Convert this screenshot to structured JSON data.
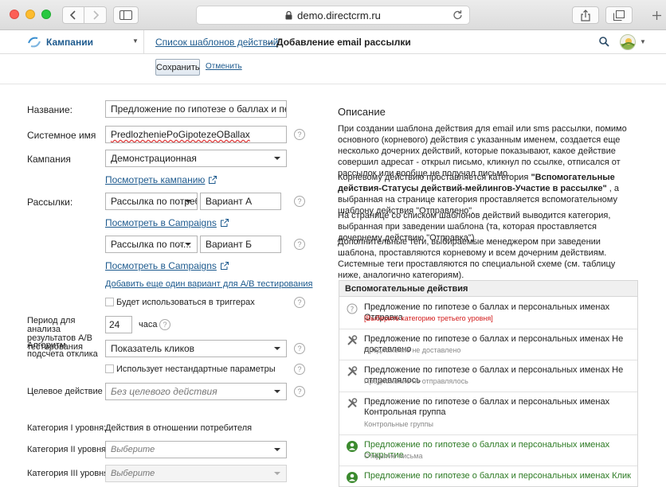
{
  "browser": {
    "url": "demo.directcrm.ru"
  },
  "header": {
    "section": "Кампании",
    "breadcrumb_link": "Список шаблонов действий",
    "breadcrumb_arrow": "→",
    "breadcrumb_current": "Добавление email рассылки"
  },
  "toolbar": {
    "save_label": "Сохранить",
    "cancel_label": "Отменить"
  },
  "form": {
    "name_label": "Название:",
    "name_value": "Предложение по гипотезе о баллах и персональн",
    "sysname_label": "Системное имя",
    "sysname_value": "PredlozheniePoGipotezeOBallax",
    "campaign_label": "Кампания",
    "campaign_value": "Демонстрационная",
    "view_campaign": "Посмотреть кампанию",
    "mailings_label": "Рассылки:",
    "mailing_a_select": "Рассылка по потребе...",
    "mailing_a_variant": "Вариант А",
    "view_in_campaigns_a": "Посмотреть в Campaigns",
    "mailing_b_select": "Рассылка по пот...",
    "mailing_b_variant": "Вариант Б",
    "view_in_campaigns_b": "Посмотреть в Campaigns",
    "add_variant": "Добавить еще один вариант для A/B тестирования",
    "used_in_triggers": "Будет использоваться в триггерах",
    "period_label": "Период для анализа результатов A/B тестирования",
    "period_value": "24",
    "period_unit": "часа",
    "algo_label": "Алгоритм подсчета отклика",
    "algo_value": "Показатель кликов",
    "nonstandard_params": "Использует нестандартные параметры",
    "target_label": "Целевое действие",
    "target_placeholder": "Без целевого действия",
    "cat1_label": "Категория I уровня:",
    "cat1_value": "Действия в отношении потребителя",
    "cat2_label": "Категория II уровня",
    "cat2_placeholder": "Выберите",
    "cat3_label": "Категория III уровня",
    "cat3_placeholder": "Выберите"
  },
  "description": {
    "title": "Описание",
    "p1": "При создании шаблона действия для email или sms рассылки, помимо основного (корневого) действия с указанным именем, создается еще несколько дочерних действий, которые показывают, какое действие совершил адресат - открыл письмо, кликнул по ссылке, отписался от рассылок или вообще не получал письмо.",
    "p2_a": "Корневому действию проставляется категория ",
    "p2_b": "\"Вспомогательные действия-Статусы действий-мейлингов-Участие в рассылке\"",
    "p2_c": " , а выбранная на странице категория проставляется вспомогательному шаблону действия \"Отправлено\".",
    "p3": "На странице со списком шаблонов действий выводится категория, выбранная при заведении шаблона (та, которая проставляется дочернему действию \"Отправка\").",
    "p4": "Дополнительные теги, выбираемые менеджером при заведении шаблона, проставляются корневому и всем дочерним действиям. Системные теги проставляются по специальной схеме (см. таблицу ниже, аналогично категориям)."
  },
  "actions_panel": {
    "header": "Вспомогательные действия",
    "items": [
      {
        "icon": "question-circle-icon",
        "title": "Предложение по гипотезе о баллах и персональных именах Отправка",
        "sub": "[Выберите категорию третьего уровня]",
        "sub_style": "error"
      },
      {
        "icon": "tools-icon",
        "title": "Предложение по гипотезе о баллах и персональных именах Не доставлено",
        "sub": "Предложение не доставлено"
      },
      {
        "icon": "tools-icon",
        "title": "Предложение по гипотезе о баллах и персональных именах Не отправлялось",
        "sub": "Предложение не отправлялось"
      },
      {
        "icon": "tools-icon",
        "title": "Предложение по гипотезе о баллах и персональных именах Контрольная группа",
        "sub": "Контрольные группы"
      },
      {
        "icon": "person-icon",
        "title": "Предложение по гипотезе о баллах и персональных именах Открытие",
        "sub": "Открытие письма"
      },
      {
        "icon": "person-icon",
        "title": "Предложение по гипотезе о баллах и персональных именах Клик",
        "sub": ""
      }
    ]
  },
  "colors": {
    "link": "#1d5a8e",
    "error": "#d21a1a",
    "success": "#2c7a23"
  }
}
